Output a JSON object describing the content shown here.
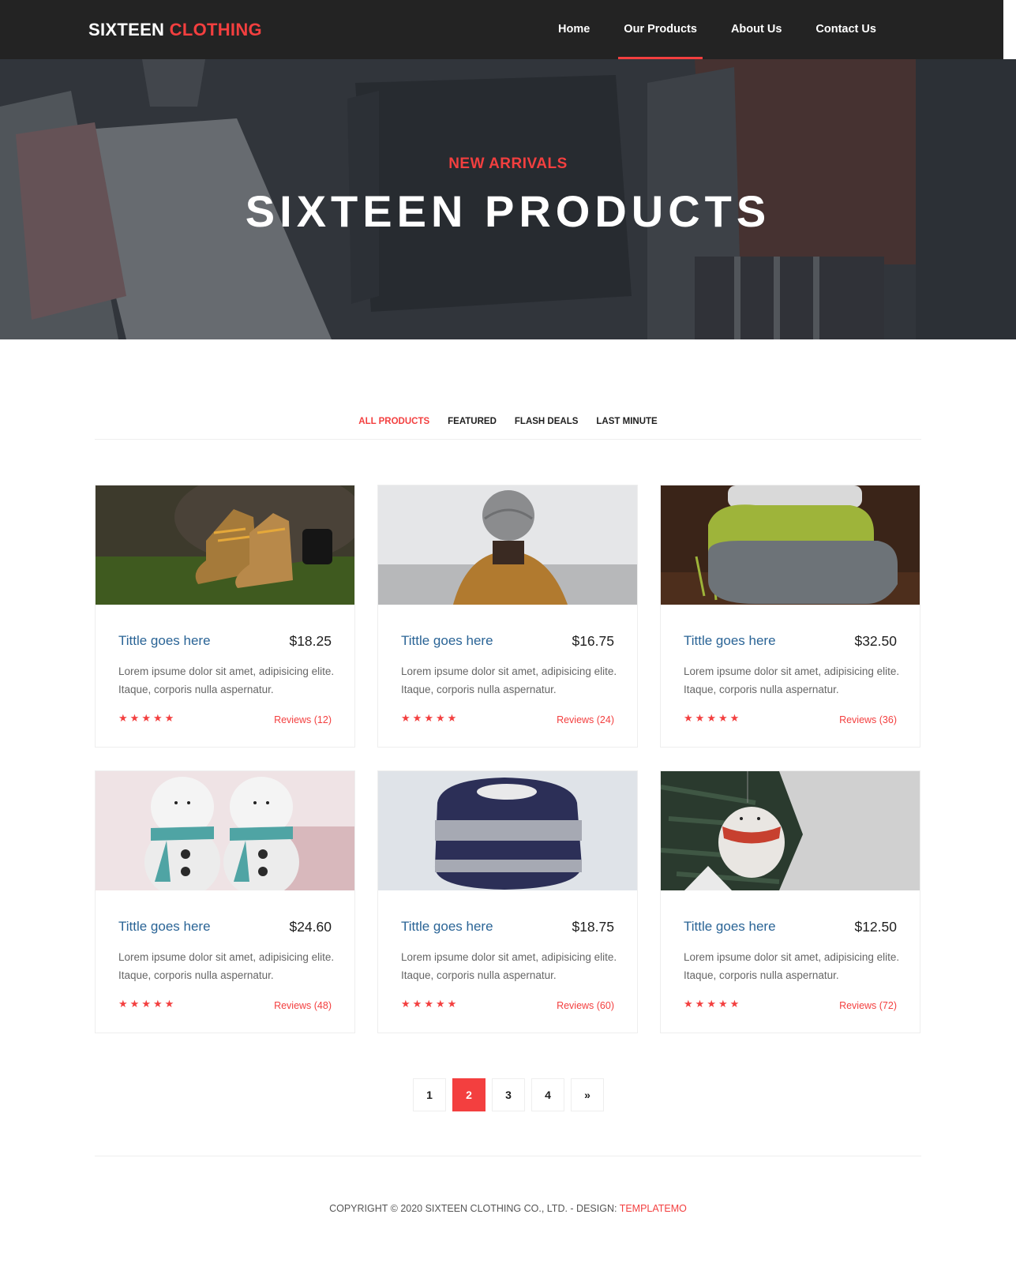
{
  "brand": {
    "part1": "SIXTEEN",
    "part2": "CLOTHING"
  },
  "nav": {
    "items": [
      {
        "label": "Home"
      },
      {
        "label": "Our Products"
      },
      {
        "label": "About Us"
      },
      {
        "label": "Contact Us"
      }
    ],
    "active_index": 1
  },
  "hero": {
    "subtitle": "NEW ARRIVALS",
    "title": "SIXTEEN PRODUCTS"
  },
  "filters": {
    "items": [
      "ALL PRODUCTS",
      "FEATURED",
      "FLASH DEALS",
      "LAST MINUTE"
    ],
    "active_index": 0
  },
  "products": [
    {
      "title": "Tittle goes here",
      "price": "$18.25",
      "description": "Lorem ipsume dolor sit amet, adipisicing elite. Itaque, corporis nulla aspernatur.",
      "reviews": "Reviews (12)",
      "rating": 5,
      "image": "boots"
    },
    {
      "title": "Tittle goes here",
      "price": "$16.75",
      "description": "Lorem ipsume dolor sit amet, adipisicing elite. Itaque, corporis nulla aspernatur.",
      "reviews": "Reviews (24)",
      "rating": 5,
      "image": "beanie-jacket"
    },
    {
      "title": "Tittle goes here",
      "price": "$32.50",
      "description": "Lorem ipsume dolor sit amet, adipisicing elite. Itaque, corporis nulla aspernatur.",
      "reviews": "Reviews (36)",
      "rating": 5,
      "image": "scarves"
    },
    {
      "title": "Tittle goes here",
      "price": "$24.60",
      "description": "Lorem ipsume dolor sit amet, adipisicing elite. Itaque, corporis nulla aspernatur.",
      "reviews": "Reviews (48)",
      "rating": 5,
      "image": "snowmen"
    },
    {
      "title": "Tittle goes here",
      "price": "$18.75",
      "description": "Lorem ipsume dolor sit amet, adipisicing elite. Itaque, corporis nulla aspernatur.",
      "reviews": "Reviews (60)",
      "rating": 5,
      "image": "sweater"
    },
    {
      "title": "Tittle goes here",
      "price": "$12.50",
      "description": "Lorem ipsume dolor sit amet, adipisicing elite. Itaque, corporis nulla aspernatur.",
      "reviews": "Reviews (72)",
      "rating": 5,
      "image": "ornament"
    }
  ],
  "pagination": {
    "pages": [
      "1",
      "2",
      "3",
      "4"
    ],
    "active": "2",
    "next": "»"
  },
  "footer": {
    "copyright": "COPYRIGHT © 2020 SIXTEEN CLOTHING CO., LTD. - DESIGN:",
    "design_link": "TEMPLATEMO"
  },
  "colors": {
    "accent": "#f33f3f",
    "header_bg": "#232323",
    "title_blue": "#2a6496"
  }
}
